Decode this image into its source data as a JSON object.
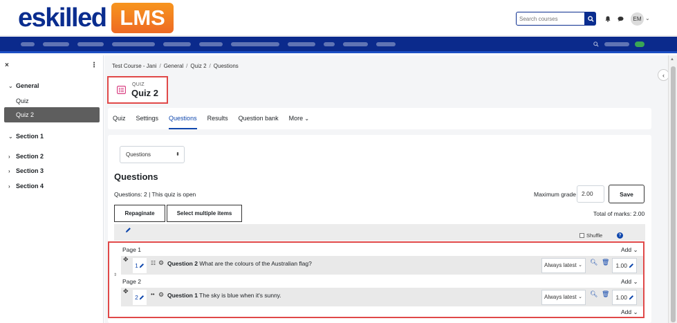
{
  "brand": {
    "logo_text": "eskilled",
    "logo_badge": "LMS",
    "primary": "#0b2a8c",
    "accent": "#f28a1f"
  },
  "search": {
    "placeholder": "Search courses"
  },
  "user": {
    "initials": "EM"
  },
  "sidebar": {
    "close_icon": "×",
    "kebab_icon": "⋮",
    "sections": [
      {
        "label": "General",
        "expanded": true,
        "items": [
          "Quiz",
          "Quiz 2"
        ]
      },
      {
        "label": "Section 1",
        "expanded": true,
        "items": []
      },
      {
        "label": "Section 2",
        "expanded": false,
        "items": []
      },
      {
        "label": "Section 3",
        "expanded": false,
        "items": []
      },
      {
        "label": "Section 4",
        "expanded": false,
        "items": []
      }
    ],
    "active_item": "Quiz 2"
  },
  "breadcrumb": [
    "Test Course - Jani",
    "General",
    "Quiz 2",
    "Questions"
  ],
  "activity": {
    "type": "QUIZ",
    "title": "Quiz 2"
  },
  "tabs": [
    {
      "label": "Quiz",
      "active": false
    },
    {
      "label": "Settings",
      "active": false
    },
    {
      "label": "Questions",
      "active": true
    },
    {
      "label": "Results",
      "active": false
    },
    {
      "label": "Question bank",
      "active": false
    },
    {
      "label": "More",
      "active": false
    }
  ],
  "questions_page": {
    "select_value": "Questions",
    "heading": "Questions",
    "status": "Questions: 2 | This quiz is open",
    "max_grade_label": "Maximum grade",
    "max_grade_value": "2.00",
    "save_label": "Save",
    "repaginate_label": "Repaginate",
    "select_multiple_label": "Select multiple items",
    "total_marks": "Total of marks: 2.00",
    "shuffle_label": "Shuffle",
    "add_label": "Add",
    "pages": [
      {
        "label": "Page 1",
        "question": {
          "number": "1",
          "name": "Question 2",
          "text": "What are the colours of the Australian flag?",
          "version": "Always latest",
          "mark": "1.00"
        }
      },
      {
        "label": "Page 2",
        "question": {
          "number": "2",
          "name": "Question 1",
          "text": "The sky is blue when it's sunny.",
          "version": "Always latest",
          "mark": "1.00"
        }
      }
    ]
  }
}
